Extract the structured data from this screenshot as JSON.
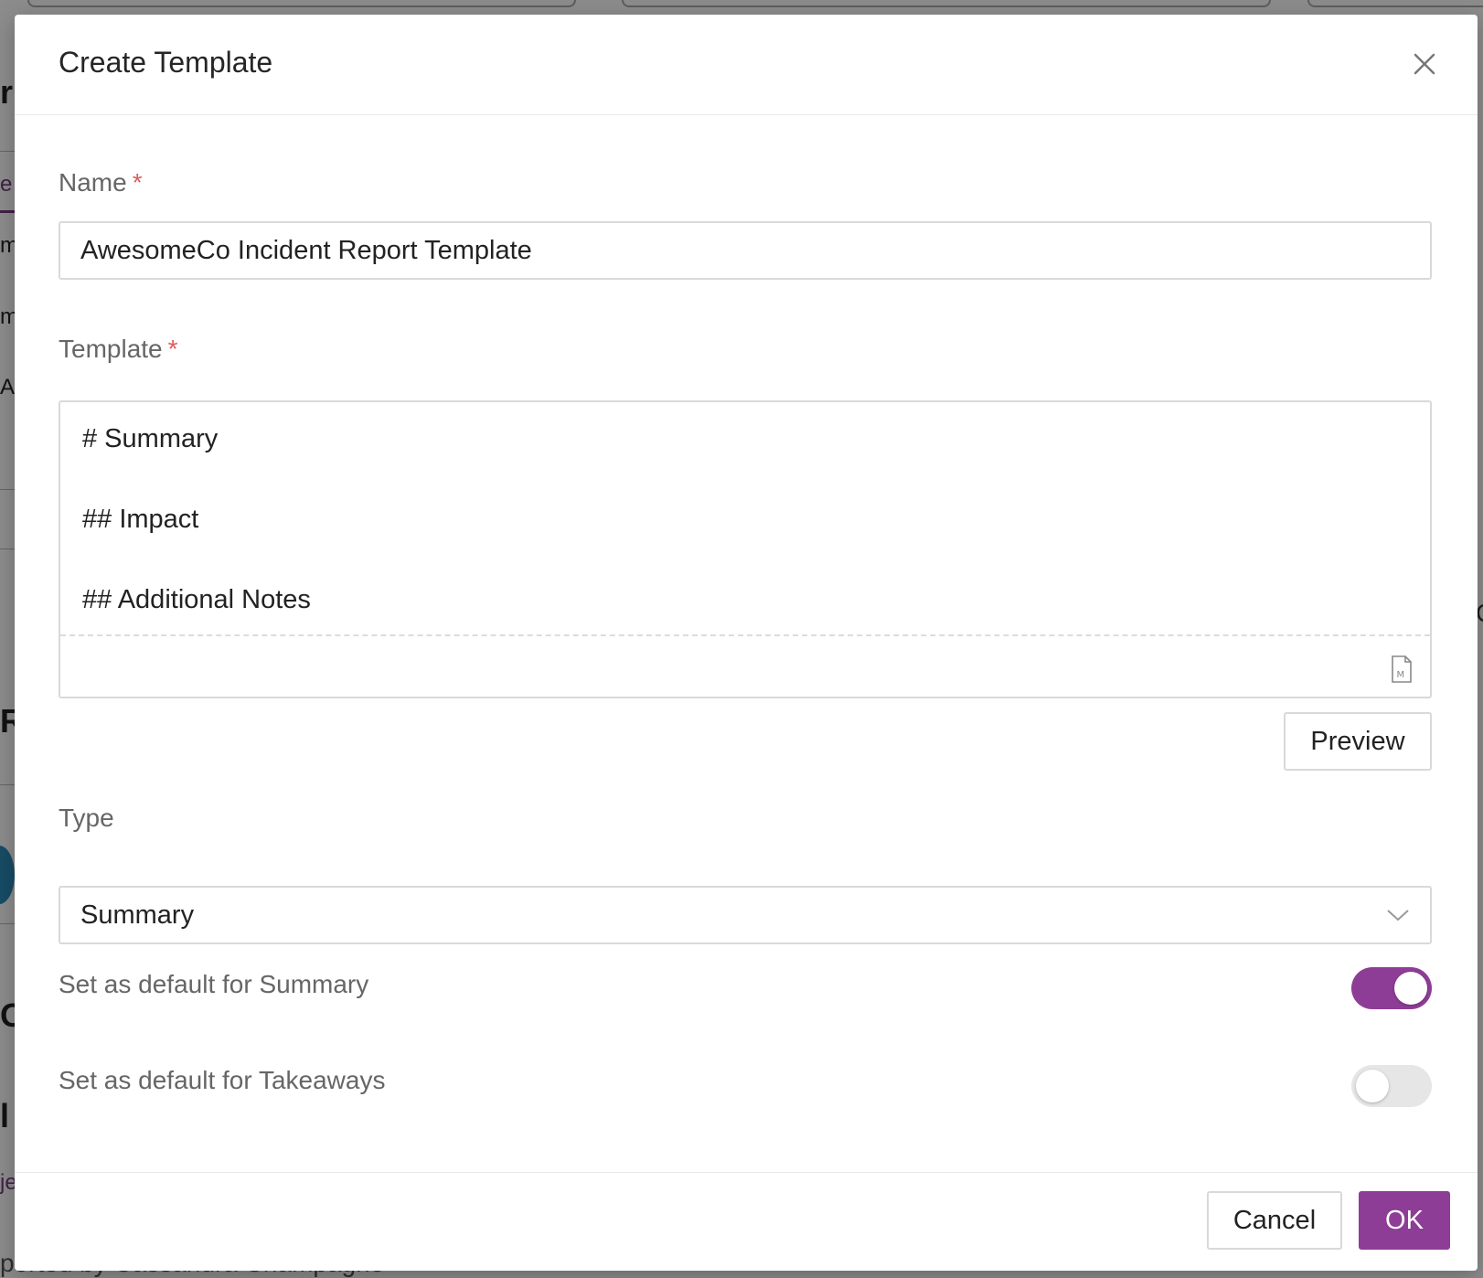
{
  "background": {
    "fragments": [
      "r",
      "e",
      "m",
      "m",
      "A",
      "R",
      "O",
      "l",
      "je"
    ],
    "bottom_text": "ported by Cassandra Champagne",
    "right_fragment": "C"
  },
  "modal": {
    "title": "Create Template",
    "close_icon": "close-icon",
    "name_field": {
      "label": "Name",
      "required_mark": "*",
      "value": "AwesomeCo Incident Report Template"
    },
    "template_field": {
      "label": "Template",
      "required_mark": "*",
      "lines": [
        "# Summary",
        "## Impact",
        "## Additional Notes"
      ],
      "markdown_icon": "markdown-file-icon"
    },
    "preview_label": "Preview",
    "type_field": {
      "label": "Type",
      "selected": "Summary",
      "chevron_icon": "chevron-down-icon"
    },
    "toggles": [
      {
        "label": "Set as default for Summary",
        "on": true
      },
      {
        "label": "Set as default for Takeaways",
        "on": false
      }
    ],
    "footer": {
      "cancel_label": "Cancel",
      "ok_label": "OK"
    }
  },
  "colors": {
    "accent": "#8e3d96",
    "required": "#e05a5a",
    "border": "#d9d9d9",
    "label": "#666666"
  }
}
